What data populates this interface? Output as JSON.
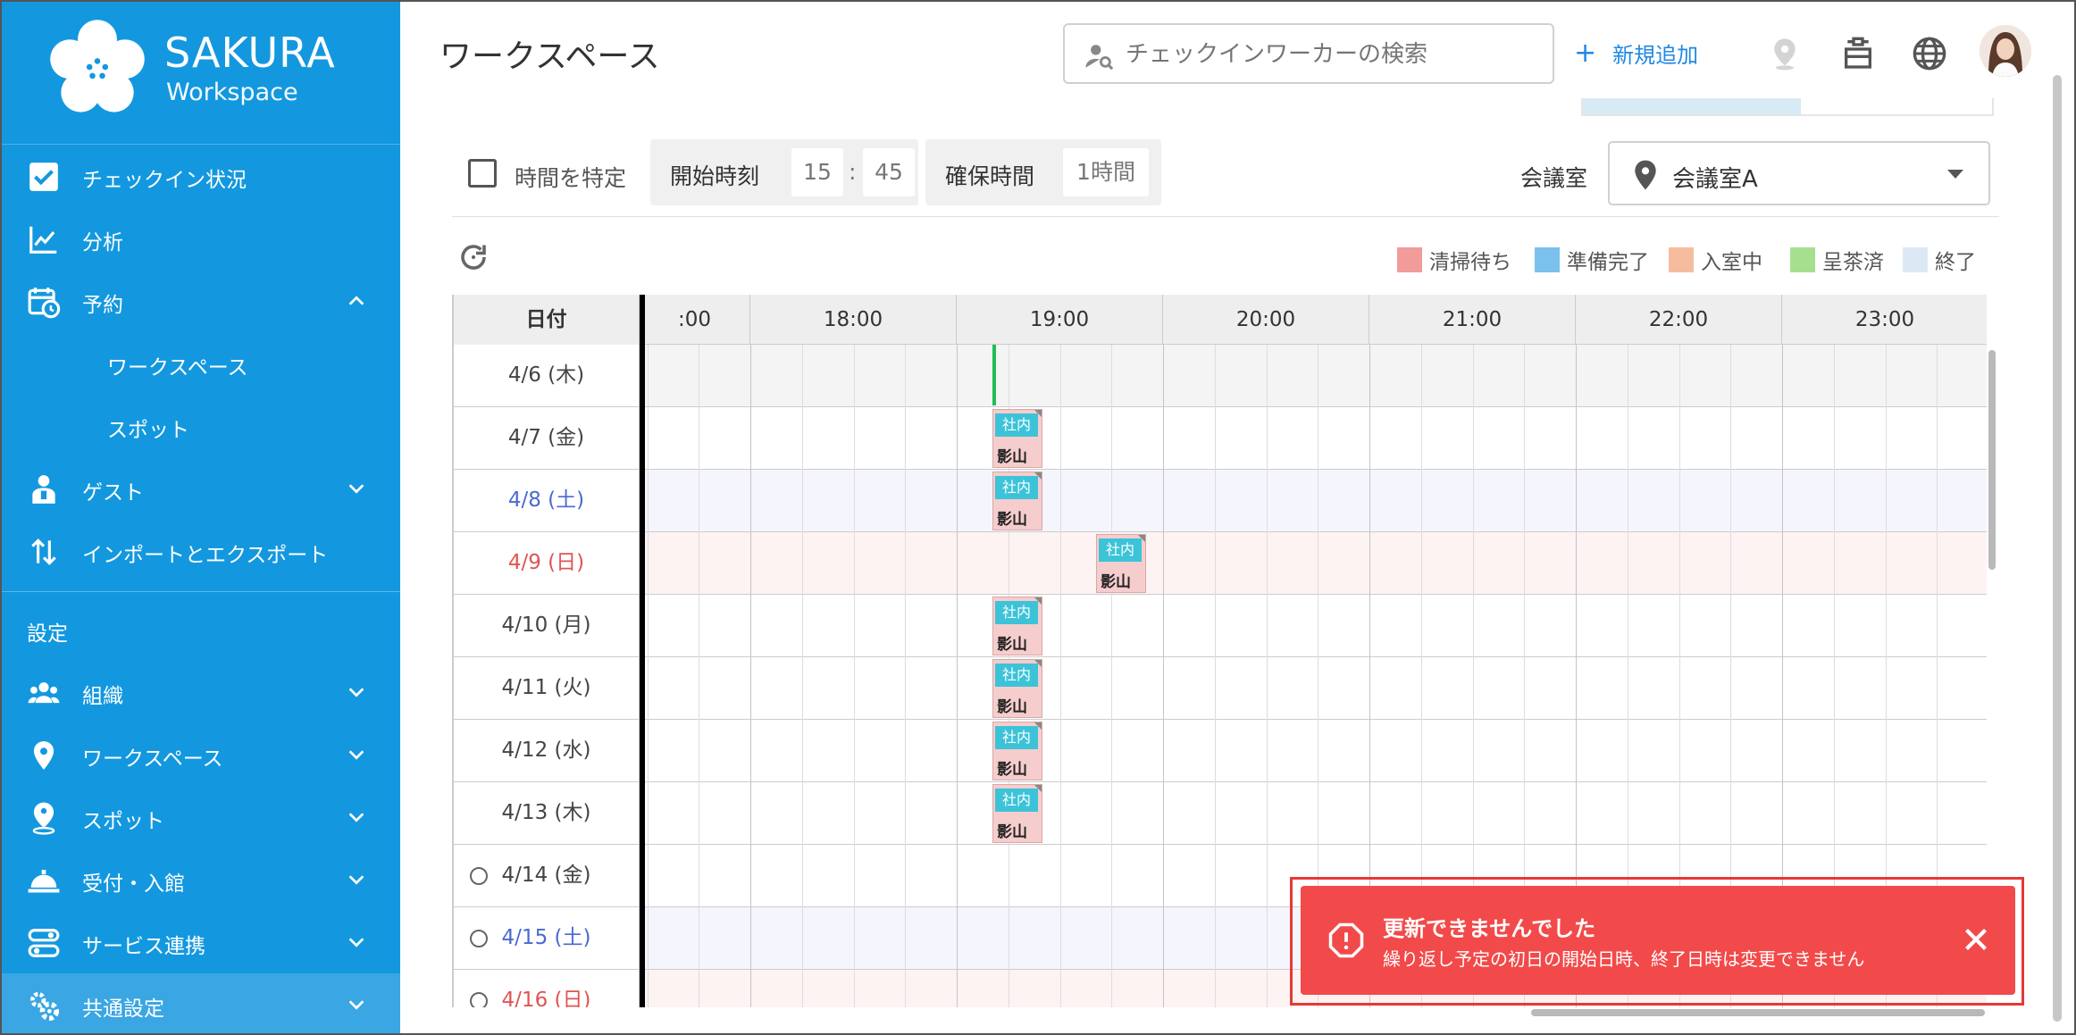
{
  "brand": {
    "title": "SAKURA",
    "subtitle": "Workspace"
  },
  "sidebar": {
    "items": [
      {
        "label": "チェックイン状況"
      },
      {
        "label": "分析"
      },
      {
        "label": "予約"
      },
      {
        "label": "ワークスペース"
      },
      {
        "label": "スポット"
      },
      {
        "label": "ゲスト"
      },
      {
        "label": "インポートとエクスポート"
      }
    ],
    "settings_label": "設定",
    "settings_items": [
      {
        "label": "組織"
      },
      {
        "label": "ワークスペース"
      },
      {
        "label": "スポット"
      },
      {
        "label": "受付・入館"
      },
      {
        "label": "サービス連携"
      },
      {
        "label": "共通設定"
      }
    ]
  },
  "header": {
    "page_title": "ワークスペース",
    "search_placeholder": "チェックインワーカーの検索",
    "add_label": "新規追加"
  },
  "controls": {
    "specify_time_label": "時間を特定",
    "start_time_label": "開始時刻",
    "start_hour": "15",
    "time_sep": ":",
    "start_minute": "45",
    "duration_label": "確保時間",
    "duration_value": "1時間",
    "room_label": "会議室",
    "room_value": "会議室A"
  },
  "legend": [
    {
      "label": "清掃待ち",
      "color": "#f29b9b"
    },
    {
      "label": "準備完了",
      "color": "#7cc0ee"
    },
    {
      "label": "入室中",
      "color": "#f5bd9e"
    },
    {
      "label": "呈茶済",
      "color": "#a6e08f"
    },
    {
      "label": "終了",
      "color": "#dce9f5"
    }
  ],
  "grid": {
    "date_header": "日付",
    "time_headers": [
      ":00",
      "18:00",
      "19:00",
      "20:00",
      "21:00",
      "22:00",
      "23:00"
    ],
    "rows": [
      {
        "date": "4/6 (木)",
        "type": "past",
        "radio": false
      },
      {
        "date": "4/7 (金)",
        "type": "weekday",
        "radio": false
      },
      {
        "date": "4/8 (土)",
        "type": "sat",
        "radio": false
      },
      {
        "date": "4/9 (日)",
        "type": "sun",
        "radio": false
      },
      {
        "date": "4/10 (月)",
        "type": "weekday",
        "radio": false
      },
      {
        "date": "4/11 (火)",
        "type": "weekday",
        "radio": false
      },
      {
        "date": "4/12 (水)",
        "type": "weekday",
        "radio": false
      },
      {
        "date": "4/13 (木)",
        "type": "weekday",
        "radio": false
      },
      {
        "date": "4/14 (金)",
        "type": "weekday",
        "radio": true
      },
      {
        "date": "4/15 (土)",
        "type": "sat",
        "radio": true
      },
      {
        "date": "4/16 (日)",
        "type": "sun",
        "radio": true
      }
    ],
    "bookings": [
      {
        "row": 1,
        "start": "19:00",
        "tag": "社内",
        "name": "影山"
      },
      {
        "row": 2,
        "start": "19:00",
        "tag": "社内",
        "name": "影山"
      },
      {
        "row": 3,
        "start": "19:30",
        "tag": "社内",
        "name": "影山"
      },
      {
        "row": 4,
        "start": "19:00",
        "tag": "社内",
        "name": "影山"
      },
      {
        "row": 5,
        "start": "19:00",
        "tag": "社内",
        "name": "影山"
      },
      {
        "row": 6,
        "start": "19:00",
        "tag": "社内",
        "name": "影山"
      },
      {
        "row": 7,
        "start": "19:00",
        "tag": "社内",
        "name": "影山"
      }
    ]
  },
  "toast": {
    "title": "更新できませんでした",
    "message": "繰り返し予定の初日の開始日時、終了日時は変更できません"
  },
  "colors": {
    "sidebar": "#1398df",
    "accent": "#1e88e5",
    "toast": "#f24a4a",
    "booking": "#f6cdcd",
    "tag": "#3cc3d8"
  }
}
